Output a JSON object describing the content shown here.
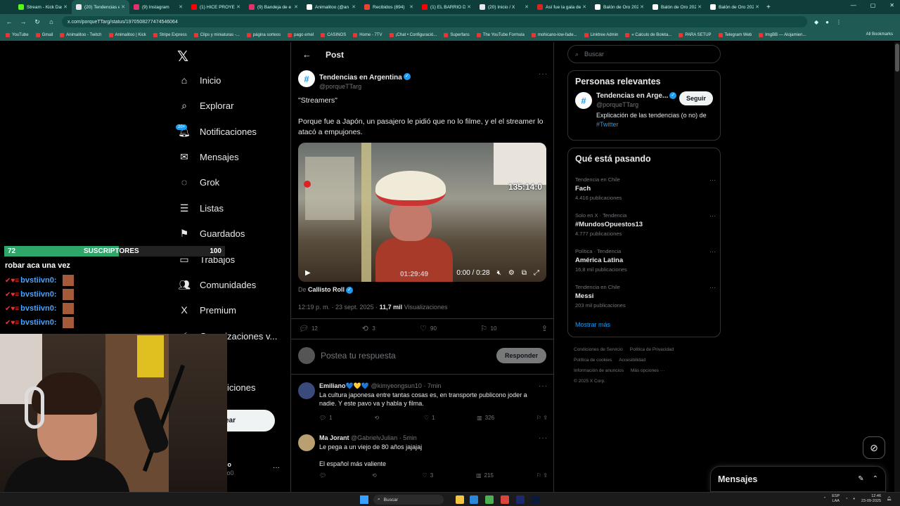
{
  "browser": {
    "tabs": [
      {
        "label": "Stream - Kick Dashbo",
        "color": "#53fc18",
        "active": false
      },
      {
        "label": "(20) Tendencias en Ar",
        "color": "#e7e9ea",
        "active": true
      },
      {
        "label": "(9) Instagram",
        "color": "#e1306c",
        "active": false
      },
      {
        "label": "(1) HICE PROYECT",
        "color": "#ff0000",
        "active": false
      },
      {
        "label": "(9) Bandeja de e",
        "color": "#e1306c",
        "active": false
      },
      {
        "label": "Animalitoo (@an",
        "color": "#ffffff",
        "active": false
      },
      {
        "label": "Recibidos (894)",
        "color": "#ea4335",
        "active": false
      },
      {
        "label": "(1) EL BARRIO DE",
        "color": "#ff0000",
        "active": false
      },
      {
        "label": "(20) Inicio / X",
        "color": "#e7e9ea",
        "active": false
      },
      {
        "label": "Así fue la gala de",
        "color": "#d22",
        "active": false
      },
      {
        "label": "Balón de Oro 202",
        "color": "#ffffff",
        "active": false
      },
      {
        "label": "Balón de Oro 202",
        "color": "#ffffff",
        "active": false
      },
      {
        "label": "Balón de Oro 202",
        "color": "#ffffff",
        "active": false
      }
    ],
    "new_tab": "+",
    "url": "x.com/porqueTTarg/status/1970508277474546064",
    "bookmarks": [
      "YouTube",
      "Gmail",
      "Animalitoo - Twitch",
      "Animalitoo | Kick",
      "Stripe Express",
      "Clips y miniaturas -...",
      "página sorteos",
      "pago emel",
      "CASINOS",
      "Home - 7TV",
      "¡Chat • Configuració...",
      "Superfans",
      "The YouTube Formula",
      "mohicano-low-fade...",
      "Linktree Admin",
      "« Calculo de Boleta...",
      "PARA SETUP",
      "Telegram Web",
      "ImgBB — Alojamien..."
    ],
    "all_bookmarks": "All Bookmarks"
  },
  "nav": {
    "items": [
      {
        "label": "Inicio",
        "icon": "⌂"
      },
      {
        "label": "Explorar",
        "icon": "⌕"
      },
      {
        "label": "Notificaciones",
        "icon": "🔔︎"
      },
      {
        "label": "Mensajes",
        "icon": "✉"
      },
      {
        "label": "Grok",
        "icon": "◌"
      },
      {
        "label": "Listas",
        "icon": "☰"
      },
      {
        "label": "Guardados",
        "icon": "⚑"
      },
      {
        "label": "Trabajos",
        "icon": "▭"
      },
      {
        "label": "Comunidades",
        "icon": "👥︎"
      },
      {
        "label": "Premium",
        "icon": "X"
      },
      {
        "label": "Organizaciones v...",
        "icon": "⚡︎"
      }
    ],
    "notif_badge": "20+",
    "partial_more": "iciones",
    "post_button_partial": "ear",
    "profile_partial_name": "oo",
    "profile_partial_handle": "ito0",
    "profile_more": "···"
  },
  "post": {
    "header_title": "Post",
    "author_name": "Tendencias en Argentina",
    "author_handle": "@porqueTTarg",
    "avatar_glyph": "#",
    "title_line": "\"Streamers\"",
    "body": "Porque fue a Japón, un pasajero le pidió que no lo filme, y el el streamer lo atacó a empujones.",
    "video": {
      "overlay_timer": "135:14:0",
      "overlay_subtitle": "01:29:49",
      "time": "0:00 / 0:28"
    },
    "via_label": "De",
    "via_name": "Callisto Roll",
    "time_date": "12:19 p. m. · 23 sept. 2025 ·",
    "views_count": "11,7 mil",
    "views_label": "Visualizaciones",
    "stats": {
      "replies": "12",
      "reposts": "3",
      "likes": "90",
      "bookmarks": "10"
    },
    "reply_placeholder": "Postea tu respuesta",
    "reply_button": "Responder"
  },
  "comments": [
    {
      "name": "Emiliano💙💛💙",
      "handle": "@kimyeongsun10 · 7min",
      "text": "La cultura japonesa entre tantas cosas es, en transporte publicono joder a nadie. Y este pavo va y habla y filma.",
      "replies": "1",
      "reposts": "",
      "likes": "1",
      "views": "326",
      "avatar_color": "#3a4a7a"
    },
    {
      "name": "Ma Jorant",
      "handle": "@GabrielvJulian · 5min",
      "text": "Le pega a un viejo de 80 años jajajaj\n\nEl español más valiente",
      "replies": "",
      "reposts": "",
      "likes": "3",
      "views": "215",
      "avatar_color": "#b8a070"
    }
  ],
  "right": {
    "search_placeholder": "Buscar",
    "relevant_title": "Personas relevantes",
    "relevant_name": "Tendencias en Arge...",
    "relevant_handle": "@porqueTTarg",
    "relevant_bio": "Explicación de las tendencias (o no) de",
    "relevant_bio_tag": "#Twitter",
    "follow_button": "Seguir",
    "trends_title": "Qué está pasando",
    "trends": [
      {
        "category": "Tendencia en Chile",
        "name": "Fach",
        "count": "4.416 publicaciones"
      },
      {
        "category": "Solo en X · Tendencia",
        "name": "#MundosOpuestos13",
        "count": "4.777 publicaciones"
      },
      {
        "category": "Política · Tendencia",
        "name": "América Latina",
        "count": "16,8 mil publicaciones"
      },
      {
        "category": "Tendencia en Chile",
        "name": "Messi",
        "count": "203 mil publicaciones"
      }
    ],
    "show_more": "Mostrar más",
    "footer": [
      "Condiciones de Servicio",
      "Política de Privacidad",
      "Política de cookies",
      "Accesibilidad",
      "Información de anuncios",
      "Más opciones ···",
      "© 2025 X Corp."
    ]
  },
  "dm": {
    "title": "Mensajes"
  },
  "stream": {
    "sub_current": "72",
    "sub_label": "SUSCRIPTORES",
    "sub_goal": "100",
    "sub_progress": 0.72,
    "chat_title": "robar aca una vez",
    "chat_lines": [
      "bvstiivn0:",
      "bvstiivn0:",
      "bvstiivn0:",
      "bvstiivn0:"
    ],
    "chat_badges": "✔♥≡"
  },
  "taskbar": {
    "search": "Buscar",
    "lang_1": "ESP",
    "lang_2": "LAA",
    "time": "12:46",
    "date": "23-09-2025"
  }
}
